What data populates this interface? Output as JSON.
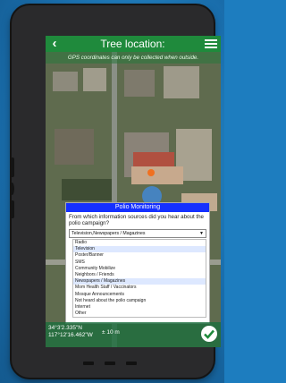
{
  "header": {
    "title": "Tree location:"
  },
  "gps_note": "GPS coordinates can only be collected when outside.",
  "dialog": {
    "title": "Polio Monitoring",
    "question": "From which information sources did you hear about the polio campaign?",
    "selected_value": "Television,Newspapers / Magazines",
    "options": [
      "Radio",
      "Television",
      "Poster/Banner",
      "SMS",
      "Community Mobilize",
      "Neighbors / Friends",
      "Newspapers / Magazines",
      "Mom Health Staff / Vaccinators",
      "Mosque Announcements",
      "Not heard about the polio campaign",
      "Internet",
      "Other"
    ],
    "checked": [
      "Television",
      "Newspapers / Magazines"
    ]
  },
  "status": {
    "lat": "34°3'2.335\"N",
    "lon": "117°12'16.462\"W",
    "accuracy": "± 10 m"
  },
  "colors": {
    "header": "#1f8a3c",
    "dialog_title": "#1530ff",
    "location_marker": "#f07020",
    "background": "#1d7dbf"
  },
  "icons": [
    "back-arrow-icon",
    "hamburger-menu-icon",
    "location-pin-icon",
    "checkmark-icon"
  ]
}
